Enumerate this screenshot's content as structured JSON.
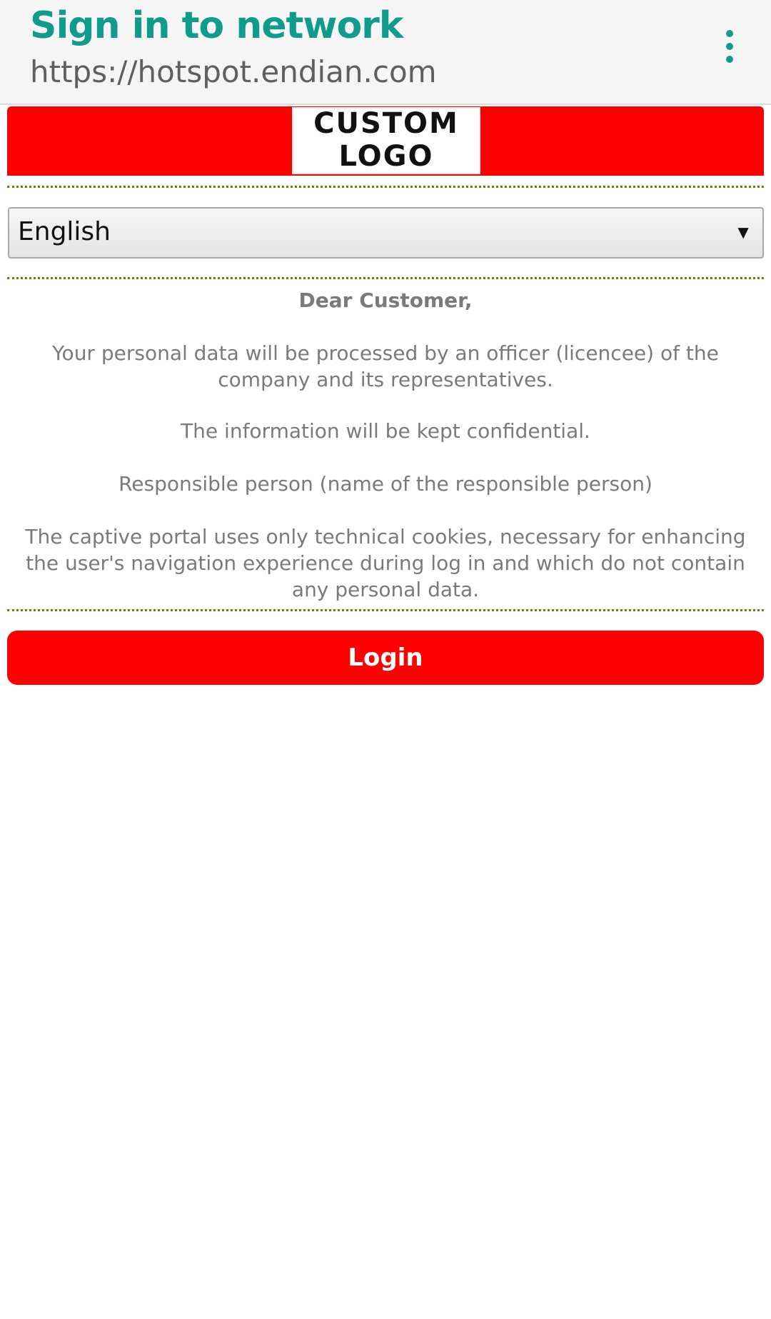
{
  "appbar": {
    "title": "Sign in to network",
    "url": "https://hotspot.endian.com",
    "menu_icon": "more-vert-icon",
    "accent_color": "#0f9c8c"
  },
  "logo": {
    "line1": "CUSTOM",
    "line2": "LOGO",
    "bar_color": "#ff0000"
  },
  "language": {
    "selected": "English",
    "arrow": "▼"
  },
  "message": {
    "greeting": "Dear Customer,",
    "paragraphs": [
      "Your personal data will be processed by an officer (licencee) of the company and its representatives.",
      "The information will be kept confidential.",
      "Responsible person (name of the responsible person)",
      "The captive portal uses only technical cookies, necessary for enhancing the user's navigation experience during log in and which do not contain any personal data."
    ]
  },
  "login": {
    "label": "Login",
    "color": "#ff0000"
  }
}
